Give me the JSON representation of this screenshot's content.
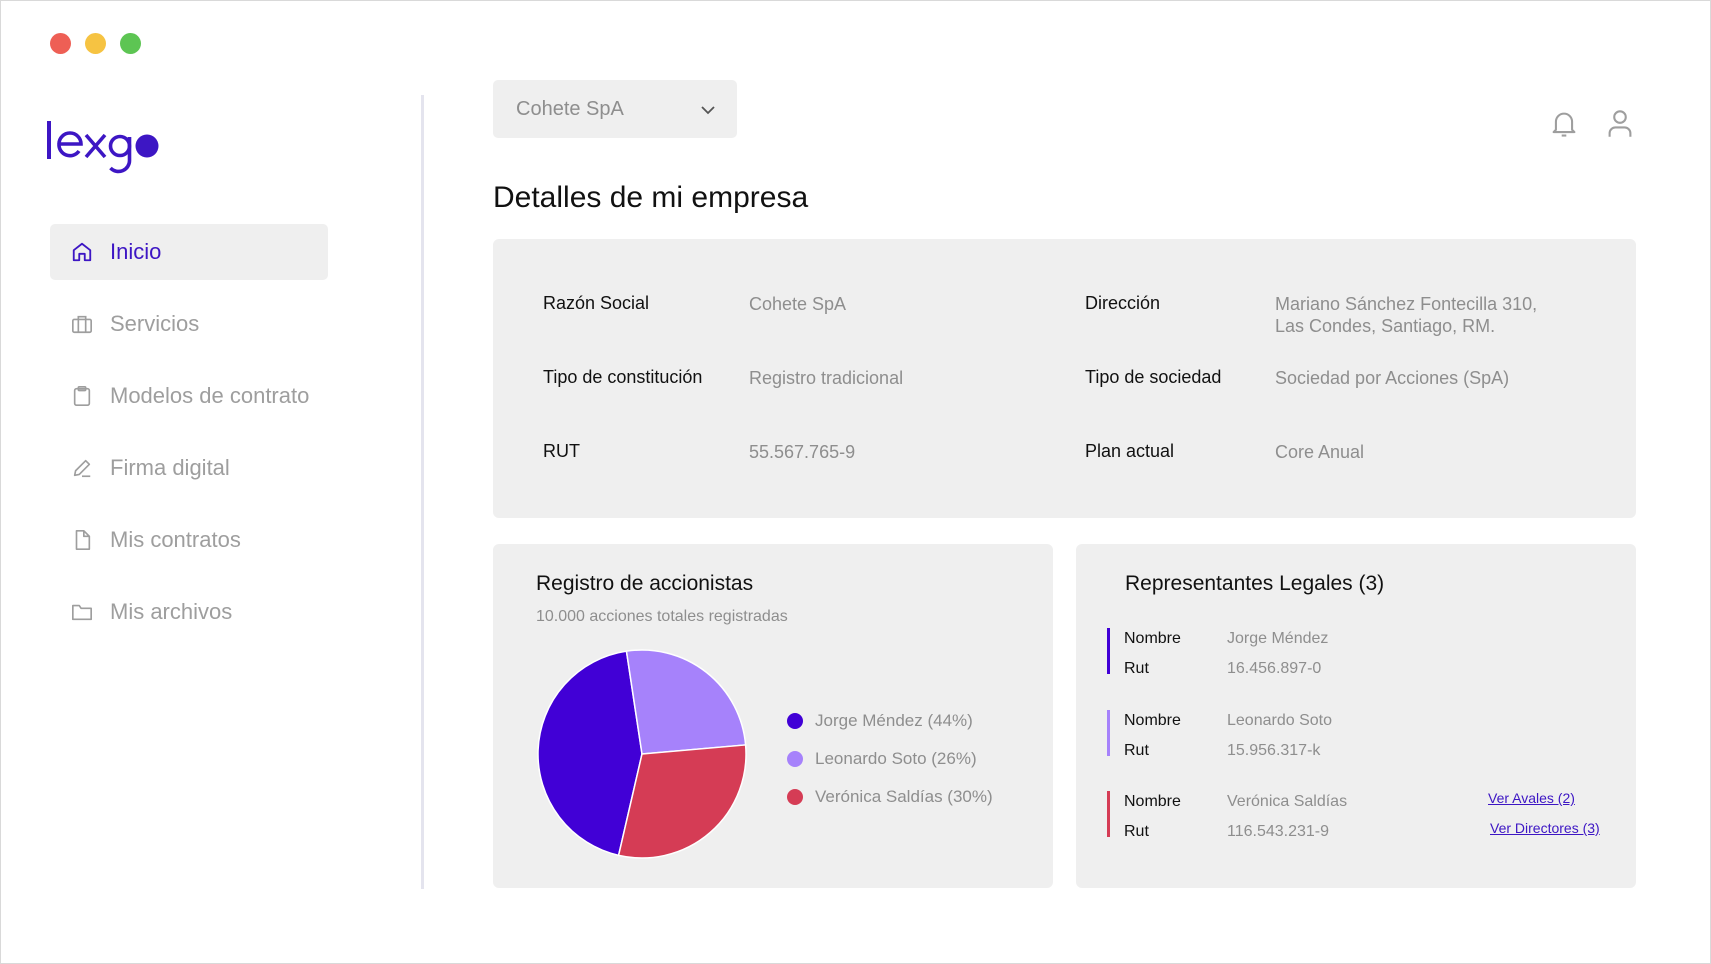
{
  "window": {
    "traffic_colors": [
      "#ee5f55",
      "#f6c342",
      "#5dc553"
    ]
  },
  "brand": {
    "logo_text": "lexgo",
    "color": "#3d16c4"
  },
  "sidebar": {
    "items": [
      {
        "label": "Inicio",
        "icon": "home-icon",
        "active": true
      },
      {
        "label": "Servicios",
        "icon": "briefcase-icon",
        "active": false
      },
      {
        "label": "Modelos de contrato",
        "icon": "clipboard-icon",
        "active": false
      },
      {
        "label": "Firma digital",
        "icon": "pen-icon",
        "active": false
      },
      {
        "label": "Mis contratos",
        "icon": "document-icon",
        "active": false
      },
      {
        "label": "Mis archivos",
        "icon": "folder-icon",
        "active": false
      }
    ]
  },
  "header": {
    "company_select": "Cohete SpA",
    "icons": [
      "bell-icon",
      "user-icon"
    ]
  },
  "page": {
    "title": "Detalles de mi empresa"
  },
  "details": {
    "razon_social_label": "Razón Social",
    "razon_social_value": "Cohete SpA",
    "tipo_constitucion_label": "Tipo de constitución",
    "tipo_constitucion_value": "Registro tradicional",
    "rut_label": "RUT",
    "rut_value": "55.567.765-9",
    "direccion_label": "Dirección",
    "direccion_line1": "Mariano Sánchez Fontecilla 310,",
    "direccion_line2": "Las Condes, Santiago, RM.",
    "tipo_sociedad_label": "Tipo de sociedad",
    "tipo_sociedad_value": "Sociedad por Acciones (SpA)",
    "plan_label": "Plan actual",
    "plan_value": "Core Anual"
  },
  "shareholders": {
    "title": "Registro de accionistas",
    "subtitle": "10.000 acciones totales registradas"
  },
  "chart_data": {
    "type": "pie",
    "categories": [
      "Jorge Méndez (44%)",
      "Leonardo Soto (26%)",
      "Verónica Saldías (30%)"
    ],
    "values": [
      44,
      26,
      30
    ],
    "colors": [
      "#4100d6",
      "#a682fb",
      "#d53c55"
    ]
  },
  "legal": {
    "title": "Representantes Legales (3)",
    "name_key": "Nombre",
    "rut_key": "Rut",
    "reps": [
      {
        "name": "Jorge Méndez",
        "rut": "16.456.897-0",
        "color": "#4100d6"
      },
      {
        "name": "Leonardo Soto",
        "rut": "15.956.317-k",
        "color": "#a682fb"
      },
      {
        "name": "Verónica Saldías",
        "rut": "116.543.231-9",
        "color": "#d53c55"
      }
    ],
    "link_avales": "Ver Avales (2)",
    "link_directores": "Ver Directores (3)"
  }
}
